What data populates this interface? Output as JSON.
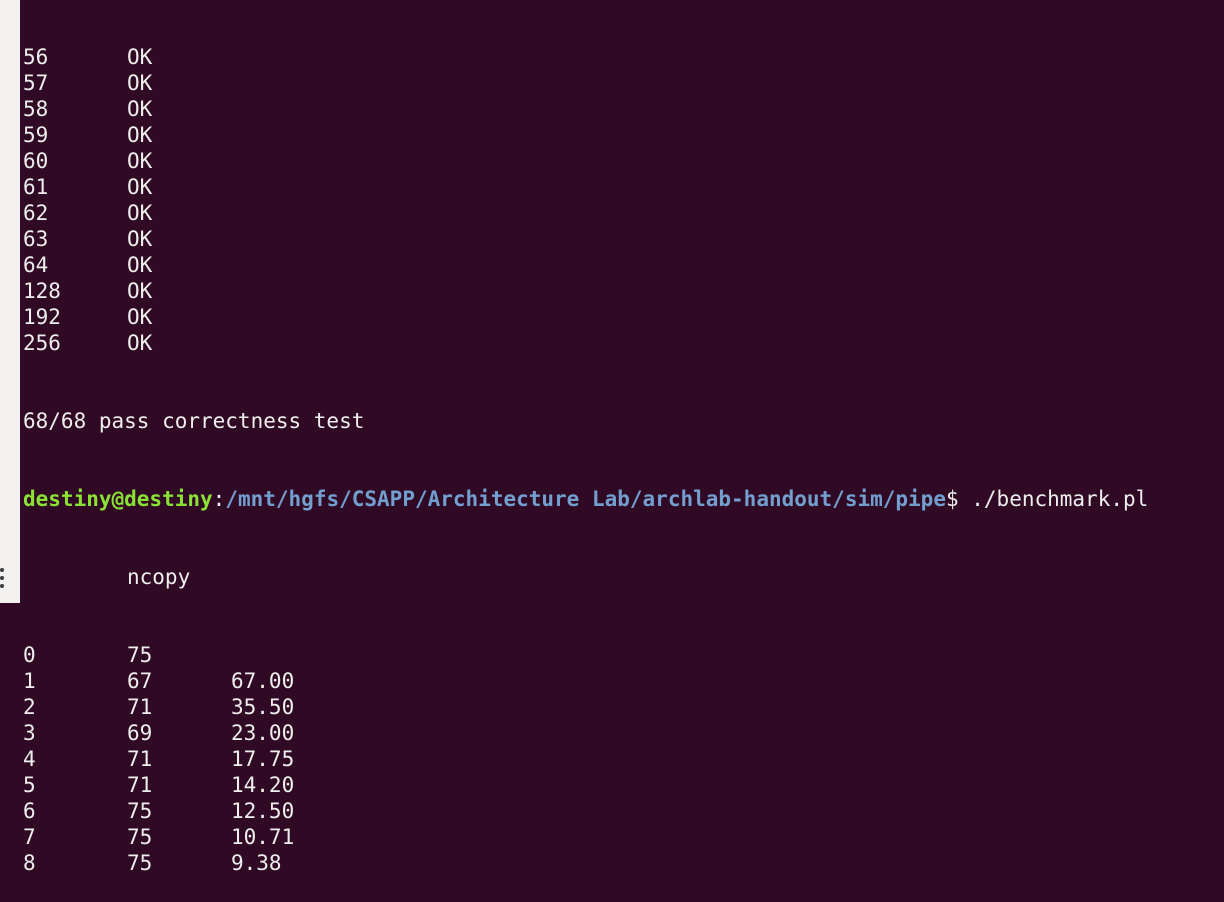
{
  "ok_rows": [
    {
      "n": "56",
      "status": "OK"
    },
    {
      "n": "57",
      "status": "OK"
    },
    {
      "n": "58",
      "status": "OK"
    },
    {
      "n": "59",
      "status": "OK"
    },
    {
      "n": "60",
      "status": "OK"
    },
    {
      "n": "61",
      "status": "OK"
    },
    {
      "n": "62",
      "status": "OK"
    },
    {
      "n": "63",
      "status": "OK"
    },
    {
      "n": "64",
      "status": "OK"
    },
    {
      "n": "128",
      "status": "OK"
    },
    {
      "n": "192",
      "status": "OK"
    },
    {
      "n": "256",
      "status": "OK"
    }
  ],
  "summary": "68/68 pass correctness test",
  "prompt": {
    "user": "destiny@destiny",
    "sep": ":",
    "path": "/mnt/hgfs/CSAPP/Architecture Lab/archlab-handout/sim/pipe",
    "dollar": "$ ",
    "command": "./benchmark.pl"
  },
  "bench_header": "ncopy",
  "bench_rows": [
    {
      "n": "0",
      "cycles": "75",
      "cpe": ""
    },
    {
      "n": "1",
      "cycles": "67",
      "cpe": "67.00"
    },
    {
      "n": "2",
      "cycles": "71",
      "cpe": "35.50"
    },
    {
      "n": "3",
      "cycles": "69",
      "cpe": "23.00"
    },
    {
      "n": "4",
      "cycles": "71",
      "cpe": "17.75"
    },
    {
      "n": "5",
      "cycles": "71",
      "cpe": "14.20"
    },
    {
      "n": "6",
      "cycles": "75",
      "cpe": "12.50"
    },
    {
      "n": "7",
      "cycles": "75",
      "cpe": "10.71"
    },
    {
      "n": "8",
      "cycles": "75",
      "cpe": "9.38"
    }
  ],
  "colors": {
    "background": "#300a24",
    "text": "#eeeeec",
    "user": "#8ae234",
    "path": "#729fcf"
  }
}
